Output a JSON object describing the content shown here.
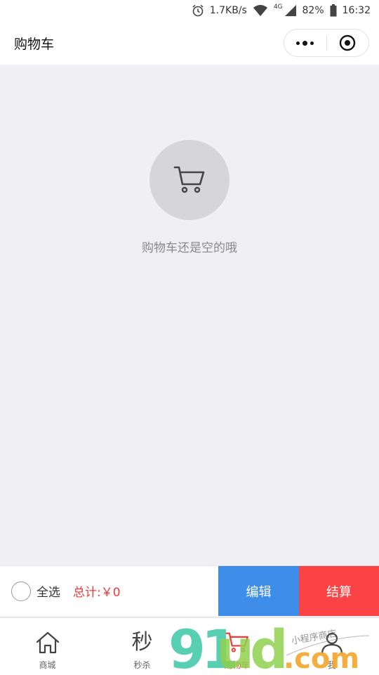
{
  "status_bar": {
    "net_speed": "1.7KB/s",
    "network_type": "4G",
    "battery": "82%",
    "time": "16:32"
  },
  "header": {
    "title": "购物车"
  },
  "empty_state": {
    "icon": "cart-icon",
    "message": "购物车还是空的哦"
  },
  "action_bar": {
    "select_all_label": "全选",
    "total_label": "总计:",
    "total_value": "￥0",
    "edit_label": "编辑",
    "checkout_label": "结算"
  },
  "tabbar": {
    "items": [
      {
        "label": "商城",
        "icon": "home-icon"
      },
      {
        "label": "秒杀",
        "icon": "秒"
      },
      {
        "label": "购物车",
        "icon": "cart-icon",
        "active": true
      },
      {
        "label": "我",
        "icon": "user-icon"
      }
    ]
  },
  "watermark": {
    "text": "91ud.com",
    "tagline": "小程序商店"
  },
  "colors": {
    "accent_blue": "#3e8de8",
    "accent_red": "#fb4345",
    "price_red": "#f33a3a",
    "background": "#efeff4"
  }
}
